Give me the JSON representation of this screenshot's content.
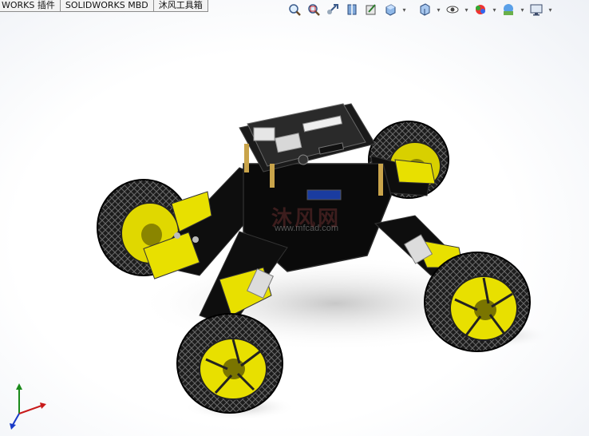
{
  "tabs": [
    {
      "label": "WORKS 插件"
    },
    {
      "label": "SOLIDWORKS MBD"
    },
    {
      "label": "沐风工具箱"
    }
  ],
  "toolbar": {
    "icons": [
      "zoom-to-fit-icon",
      "zoom-to-area-icon",
      "previous-view-icon",
      "section-view-icon",
      "dynamic-annotation-icon",
      "view-orientation-icon",
      "display-style-icon",
      "hide-show-items-icon",
      "edit-appearance-icon",
      "apply-scene-icon",
      "view-settings-icon"
    ]
  },
  "watermark": {
    "text": "沐风网",
    "url": "www.mfcad.com"
  },
  "colors": {
    "wheel_yellow": "#e8e000",
    "chassis": "#111111",
    "tire": "#1a1a1a"
  }
}
